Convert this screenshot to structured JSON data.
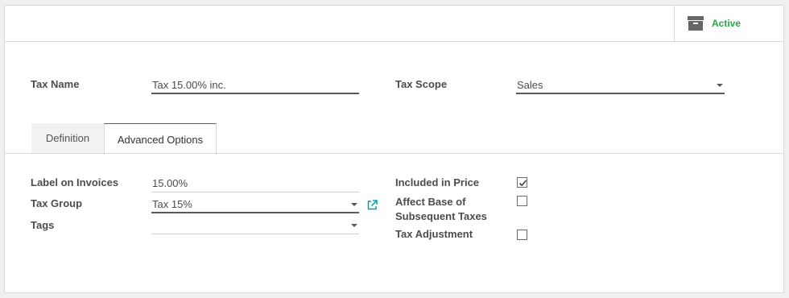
{
  "header": {
    "active_label": "Active",
    "archive_icon": "archive-icon"
  },
  "main": {
    "tax_name": {
      "label": "Tax Name",
      "value": "Tax 15.00% inc."
    },
    "tax_scope": {
      "label": "Tax Scope",
      "value": "Sales"
    }
  },
  "tabs": [
    {
      "label": "Definition",
      "active": false
    },
    {
      "label": "Advanced Options",
      "active": true
    }
  ],
  "advanced": {
    "label_on_invoices": {
      "label": "Label on Invoices",
      "value": "15.00%"
    },
    "tax_group": {
      "label": "Tax Group",
      "value": "Tax 15%"
    },
    "tags": {
      "label": "Tags",
      "value": ""
    },
    "included_in_price": {
      "label": "Included in Price",
      "checked": true
    },
    "affect_base": {
      "label": "Affect Base of Subsequent Taxes",
      "label_line1": "Affect Base of",
      "label_line2": "Subsequent Taxes",
      "checked": false
    },
    "tax_adjustment": {
      "label": "Tax Adjustment",
      "checked": false
    }
  },
  "colors": {
    "active_green": "#28a745",
    "tab_accent": "#7c4d7a",
    "link_teal": "#00a09d"
  }
}
